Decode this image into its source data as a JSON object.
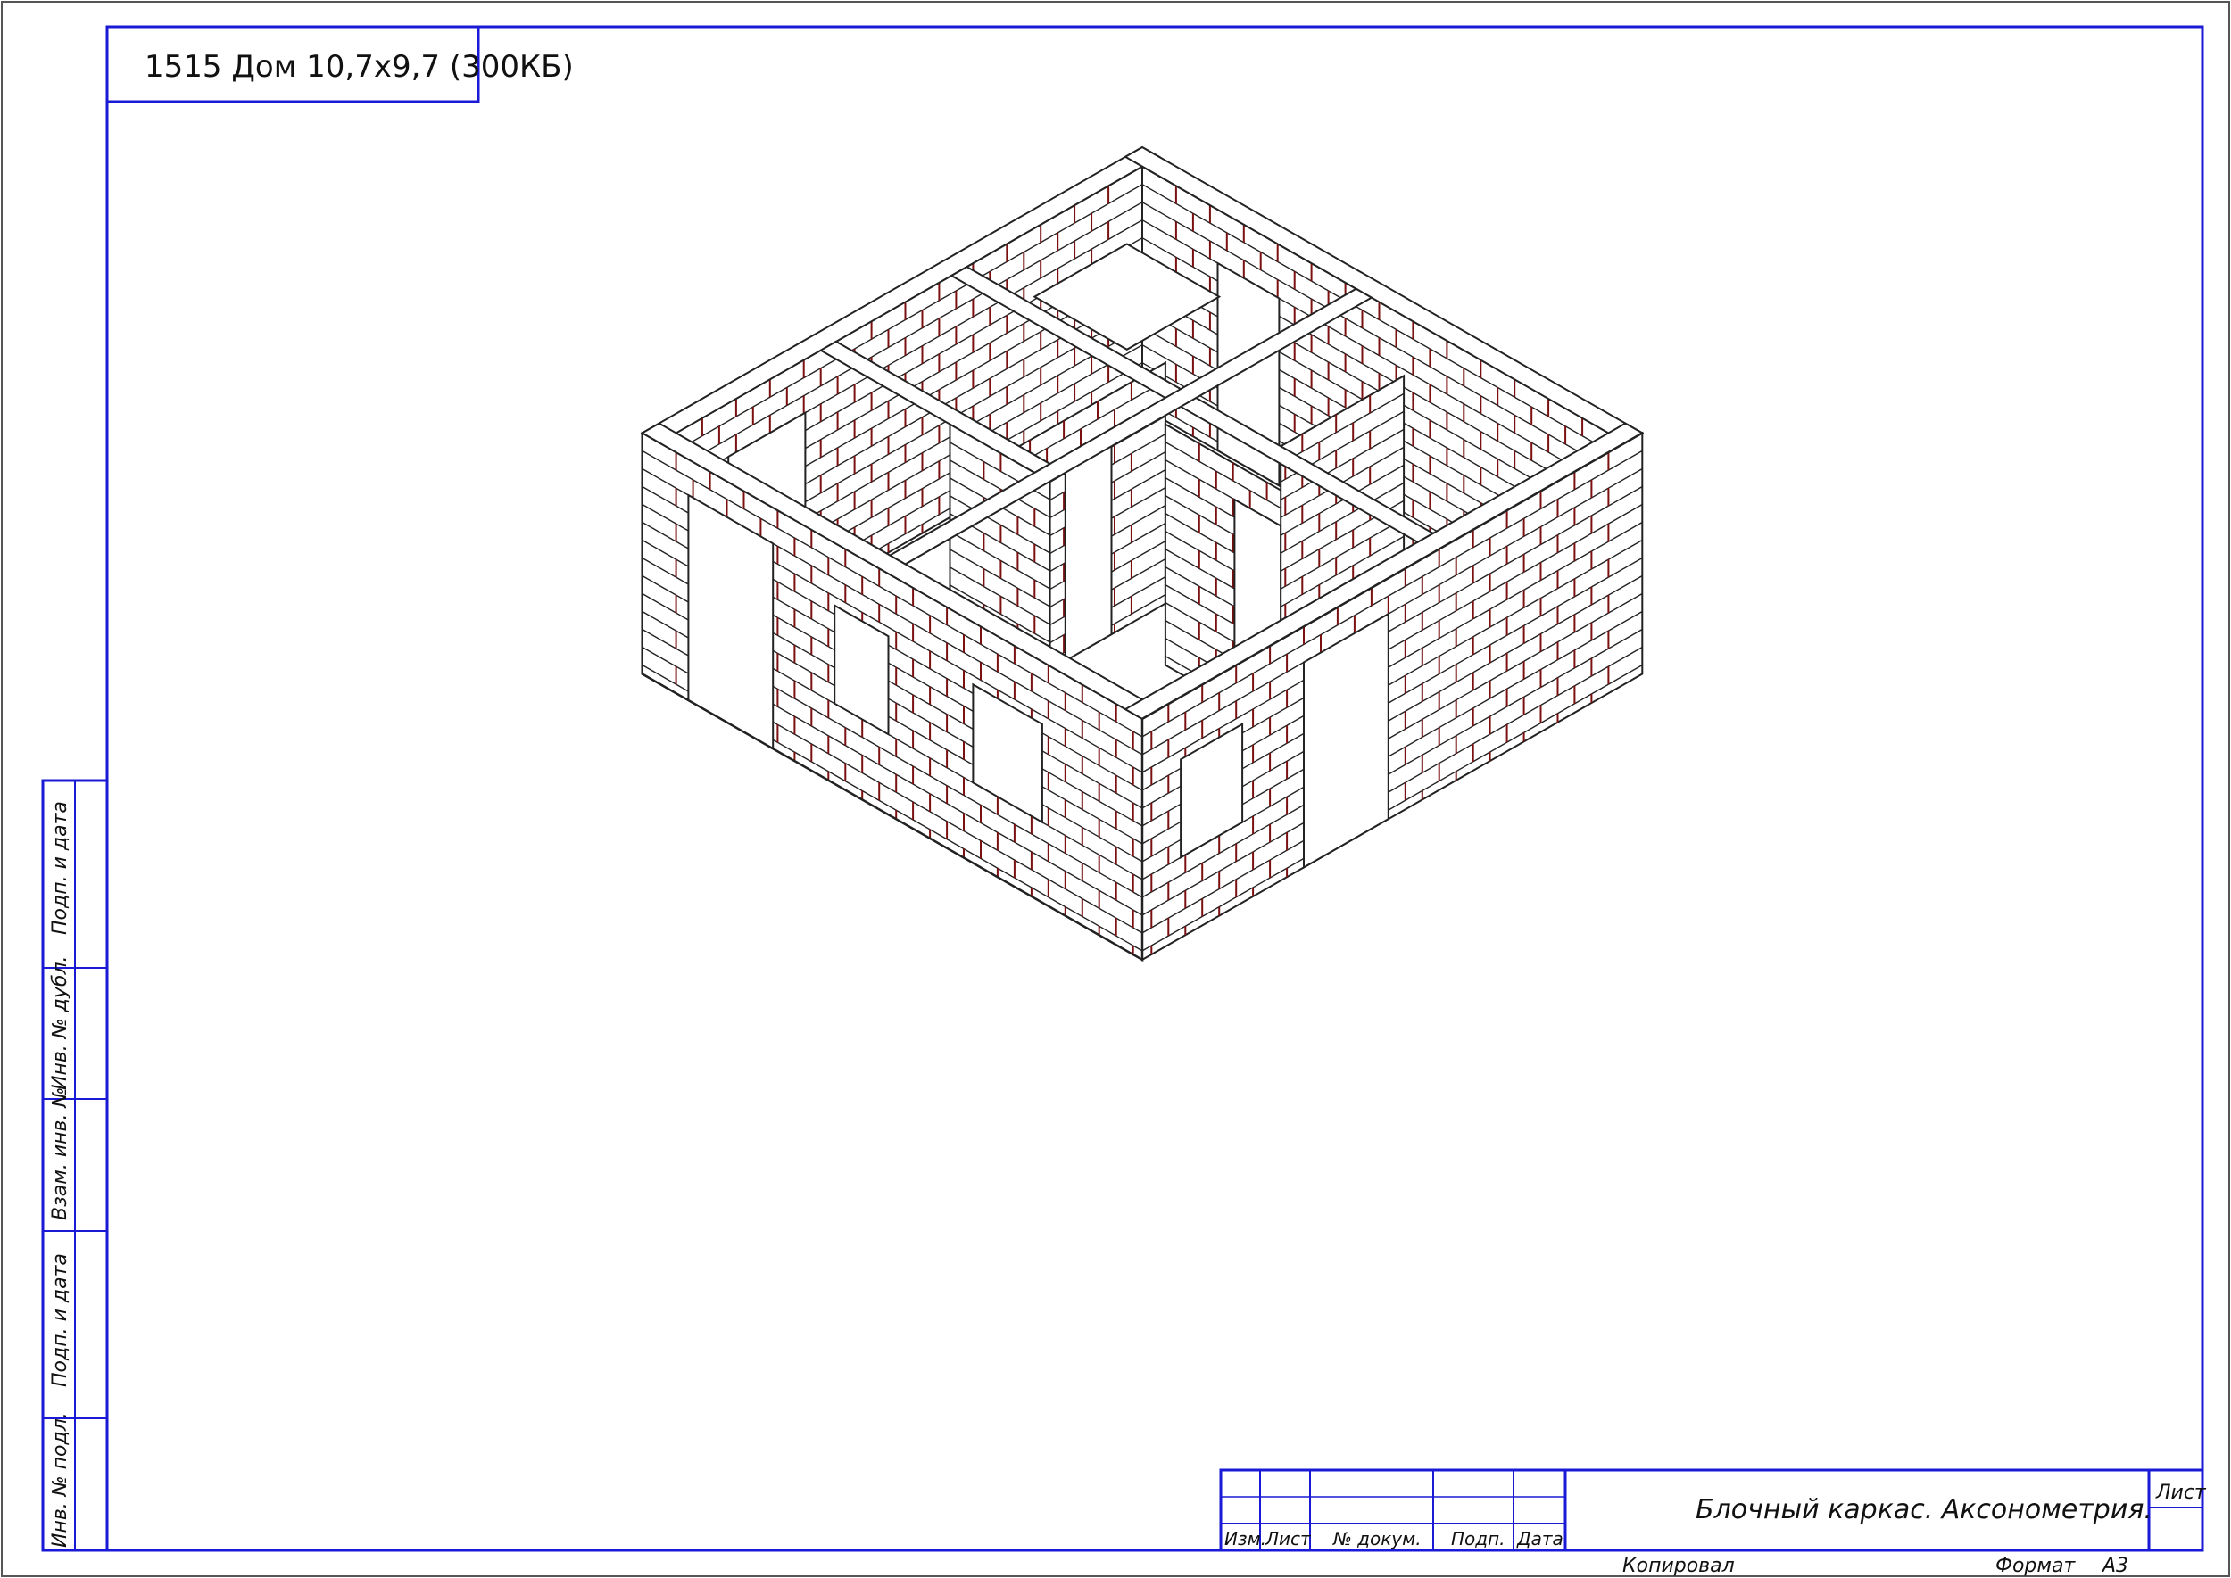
{
  "sheet": {
    "title_tab": "1515 Дом 10,7x9,7 (300КБ)",
    "side_stamp": [
      "Инв. № подл.",
      "Подп. и дата",
      "Взам. инв. №",
      "Инв. № дубл.",
      "Подп. и дата"
    ],
    "stamp": {
      "columns": [
        "Изм.",
        "Лист",
        "№ докум.",
        "Подп.",
        "Дата"
      ],
      "drawing_name": "Блочный каркас. Аксонометрия.",
      "sheet_label": "Лист"
    },
    "footer": {
      "copied": "Копировал",
      "format_label": "Формат",
      "format_value": "A3"
    }
  },
  "colors": {
    "frame": "#1a1ad6",
    "outline": "#222222",
    "mortar_joint": "#7a1010",
    "background": "#ffffff"
  }
}
